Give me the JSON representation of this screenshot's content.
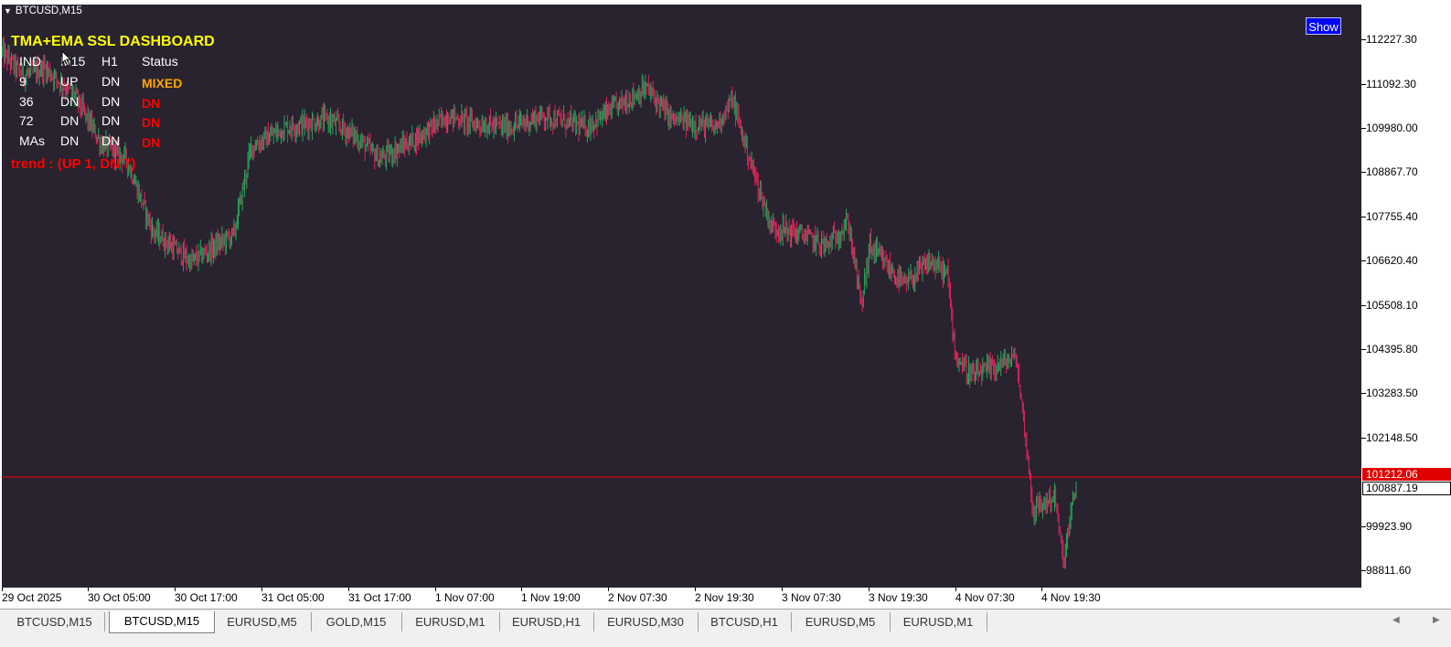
{
  "window": {
    "title": "BTCUSD,M15",
    "show_button": "Show"
  },
  "dashboard": {
    "title": "TMA+EMA SSL DASHBOARD",
    "header": [
      "IND",
      "M15",
      "H1",
      "Status"
    ],
    "rows": [
      {
        "ind": "9",
        "m15": "UP",
        "h1": "DN",
        "status": "MIXED",
        "status_color": "#ffa500"
      },
      {
        "ind": "36",
        "m15": "DN",
        "h1": "DN",
        "status": "DN",
        "status_color": "#ff0000"
      },
      {
        "ind": "72",
        "m15": "DN",
        "h1": "DN",
        "status": "DN",
        "status_color": "#ff0000"
      },
      {
        "ind": "MAs",
        "m15": "DN",
        "h1": "DN",
        "status": "DN",
        "status_color": "#ff0000"
      }
    ],
    "trend": "trend : (UP 1, DN 7)"
  },
  "price_axis": {
    "labels": [
      "112227.30",
      "111092.30",
      "109980.00",
      "108867.70",
      "107755.40",
      "106620.40",
      "105508.10",
      "104395.80",
      "103283.50",
      "102148.50",
      "99923.90",
      "98811.60"
    ],
    "current_bid": "101212.06",
    "current_ask": "100887.19"
  },
  "time_axis": {
    "labels": [
      "29 Oct 2025",
      "30 Oct 05:00",
      "30 Oct 17:00",
      "31 Oct 05:00",
      "31 Oct 17:00",
      "1 Nov 07:00",
      "1 Nov 19:00",
      "2 Nov 07:30",
      "2 Nov 19:30",
      "3 Nov 07:30",
      "3 Nov 19:30",
      "4 Nov 07:30",
      "4 Nov 19:30"
    ]
  },
  "tabs": [
    {
      "label": "BTCUSD,M15",
      "active": false
    },
    {
      "label": "BTCUSD,M15",
      "active": true
    },
    {
      "label": "EURUSD,M5",
      "active": false
    },
    {
      "label": "GOLD,M15",
      "active": false
    },
    {
      "label": "EURUSD,M1",
      "active": false
    },
    {
      "label": "EURUSD,H1",
      "active": false
    },
    {
      "label": "EURUSD,M30",
      "active": false
    },
    {
      "label": "BTCUSD,H1",
      "active": false
    },
    {
      "label": "EURUSD,M5",
      "active": false
    },
    {
      "label": "EURUSD,M1",
      "active": false
    }
  ],
  "colors": {
    "background": "#28232e",
    "bull": "#26a65b",
    "bear": "#e0245e",
    "bid_line": "#ff0000"
  },
  "chart_data": {
    "type": "candlestick",
    "symbol": "BTCUSD",
    "timeframe": "M15",
    "x": [
      "29 Oct 2025",
      "30 Oct 05:00",
      "30 Oct 17:00",
      "31 Oct 05:00",
      "31 Oct 17:00",
      "1 Nov 07:00",
      "1 Nov 19:00",
      "2 Nov 07:30",
      "2 Nov 19:30",
      "3 Nov 07:30",
      "3 Nov 19:30",
      "4 Nov 07:30",
      "4 Nov 19:30"
    ],
    "close_path": [
      {
        "t": 0,
        "price": 111900
      },
      {
        "t": 0.25,
        "price": 111300
      },
      {
        "t": 0.5,
        "price": 111500
      },
      {
        "t": 0.85,
        "price": 110800
      },
      {
        "t": 1.15,
        "price": 109600
      },
      {
        "t": 1.45,
        "price": 109200
      },
      {
        "t": 1.75,
        "price": 107400
      },
      {
        "t": 2.2,
        "price": 106600
      },
      {
        "t": 2.7,
        "price": 107300
      },
      {
        "t": 2.9,
        "price": 109500
      },
      {
        "t": 3.3,
        "price": 110000
      },
      {
        "t": 3.8,
        "price": 110200
      },
      {
        "t": 4.1,
        "price": 109800
      },
      {
        "t": 4.4,
        "price": 109200
      },
      {
        "t": 4.8,
        "price": 109700
      },
      {
        "t": 5.2,
        "price": 110300
      },
      {
        "t": 5.5,
        "price": 110100
      },
      {
        "t": 5.9,
        "price": 110000
      },
      {
        "t": 6.3,
        "price": 110300
      },
      {
        "t": 6.8,
        "price": 110000
      },
      {
        "t": 7.2,
        "price": 110600
      },
      {
        "t": 7.5,
        "price": 111000
      },
      {
        "t": 7.8,
        "price": 110200
      },
      {
        "t": 8.3,
        "price": 110000
      },
      {
        "t": 8.5,
        "price": 110700
      },
      {
        "t": 8.7,
        "price": 109200
      },
      {
        "t": 8.95,
        "price": 107500
      },
      {
        "t": 9.3,
        "price": 107300
      },
      {
        "t": 9.6,
        "price": 107000
      },
      {
        "t": 9.85,
        "price": 107600
      },
      {
        "t": 10.0,
        "price": 105500
      },
      {
        "t": 10.1,
        "price": 107000
      },
      {
        "t": 10.5,
        "price": 106000
      },
      {
        "t": 10.8,
        "price": 106600
      },
      {
        "t": 11.0,
        "price": 106300
      },
      {
        "t": 11.1,
        "price": 104200
      },
      {
        "t": 11.3,
        "price": 103700
      },
      {
        "t": 11.6,
        "price": 104000
      },
      {
        "t": 11.8,
        "price": 104200
      },
      {
        "t": 11.9,
        "price": 102400
      },
      {
        "t": 12.0,
        "price": 100300
      },
      {
        "t": 12.25,
        "price": 100700
      },
      {
        "t": 12.35,
        "price": 99000
      },
      {
        "t": 12.5,
        "price": 101000
      }
    ],
    "price_range": [
      98400,
      112700
    ],
    "bid": 101212.06,
    "ask": 100887.19
  }
}
